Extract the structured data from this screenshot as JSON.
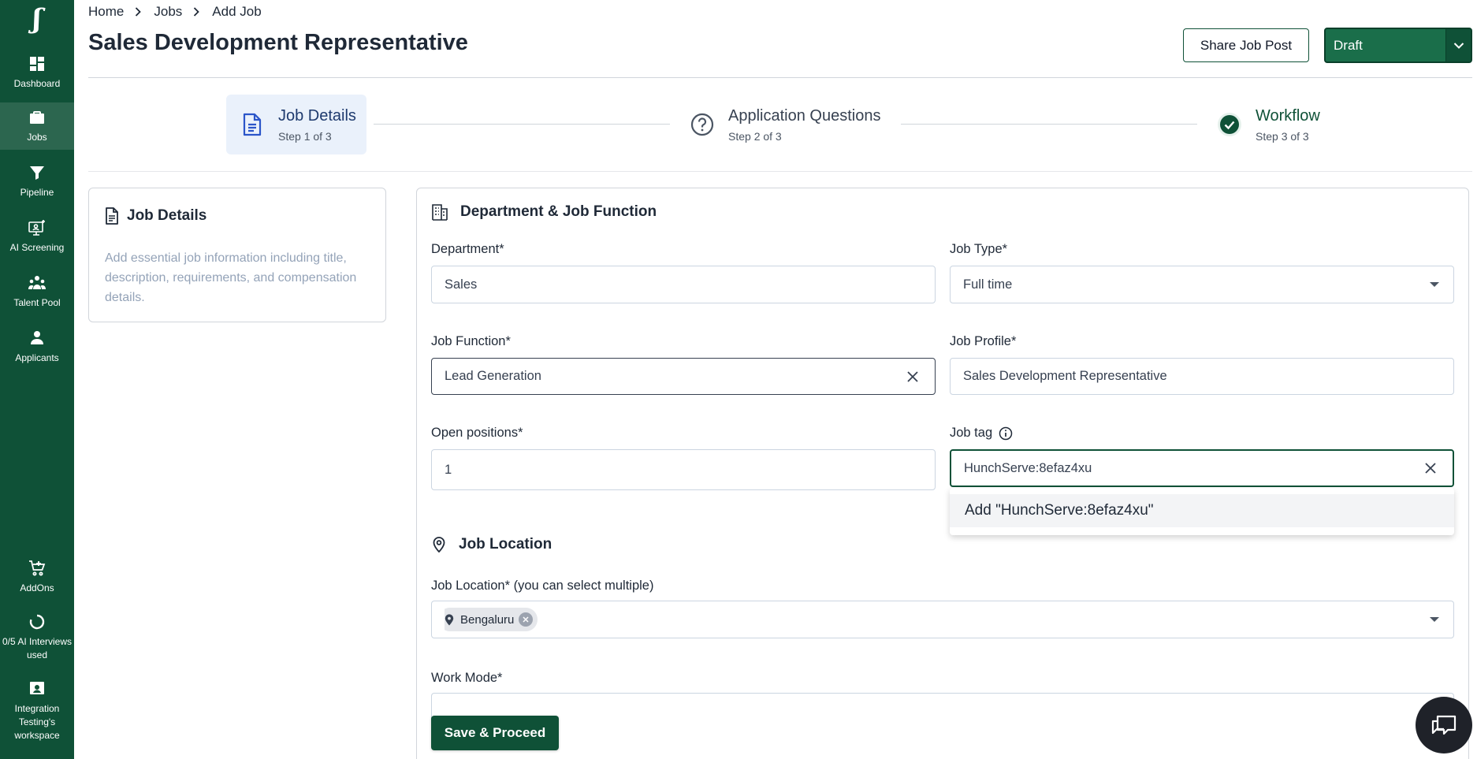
{
  "sidebar": {
    "logo": "ʃ",
    "items": [
      {
        "label": "Dashboard",
        "icon": "dashboard-icon"
      },
      {
        "label": "Jobs",
        "icon": "briefcase-icon"
      },
      {
        "label": "Pipeline",
        "icon": "filter-icon"
      },
      {
        "label": "AI Screening",
        "icon": "ai-screening-icon"
      },
      {
        "label": "Talent Pool",
        "icon": "people-icon"
      },
      {
        "label": "Applicants",
        "icon": "person-icon"
      }
    ],
    "bottom": [
      {
        "label": "AddOns",
        "icon": "cart-plus-icon"
      },
      {
        "label": "0/5 AI Interviews used",
        "icon": "progress-ring-icon"
      },
      {
        "label": "Integration Testing's workspace",
        "icon": "workspace-icon"
      }
    ]
  },
  "breadcrumb": [
    "Home",
    "Jobs",
    "Add Job"
  ],
  "page_title": "Sales Development Representative",
  "header": {
    "share_label": "Share Job Post",
    "status_label": "Draft"
  },
  "stepper": [
    {
      "title": "Job Details",
      "sub": "Step 1 of 3"
    },
    {
      "title": "Application Questions",
      "sub": "Step 2 of 3"
    },
    {
      "title": "Workflow",
      "sub": "Step 3 of 3"
    }
  ],
  "info_card": {
    "title": "Job Details",
    "description": "Add essential job information including title, description, requirements, and compensation details."
  },
  "form": {
    "section1_title": "Department & Job Function",
    "department": {
      "label": "Department*",
      "value": "Sales"
    },
    "job_type": {
      "label": "Job Type*",
      "value": "Full time"
    },
    "job_function": {
      "label": "Job Function*",
      "value": "Lead Generation"
    },
    "job_profile": {
      "label": "Job Profile*",
      "value": "Sales Development Representative"
    },
    "open_positions": {
      "label": "Open positions*",
      "value": "1"
    },
    "job_tag": {
      "label": "Job tag",
      "value": "HunchServe:8efaz4xu"
    },
    "tag_option": "Add \"HunchServe:8efaz4xu\"",
    "section2_title": "Job Location",
    "job_location": {
      "label": "Job Location* (you can select multiple)",
      "chip": "Bengaluru"
    },
    "work_mode": {
      "label": "Work Mode*"
    }
  },
  "save_label": "Save & Proceed",
  "colors": {
    "brand": "#0f5137",
    "step_active_bg": "#eaf1fb",
    "workflow_check": "#0f5137"
  }
}
